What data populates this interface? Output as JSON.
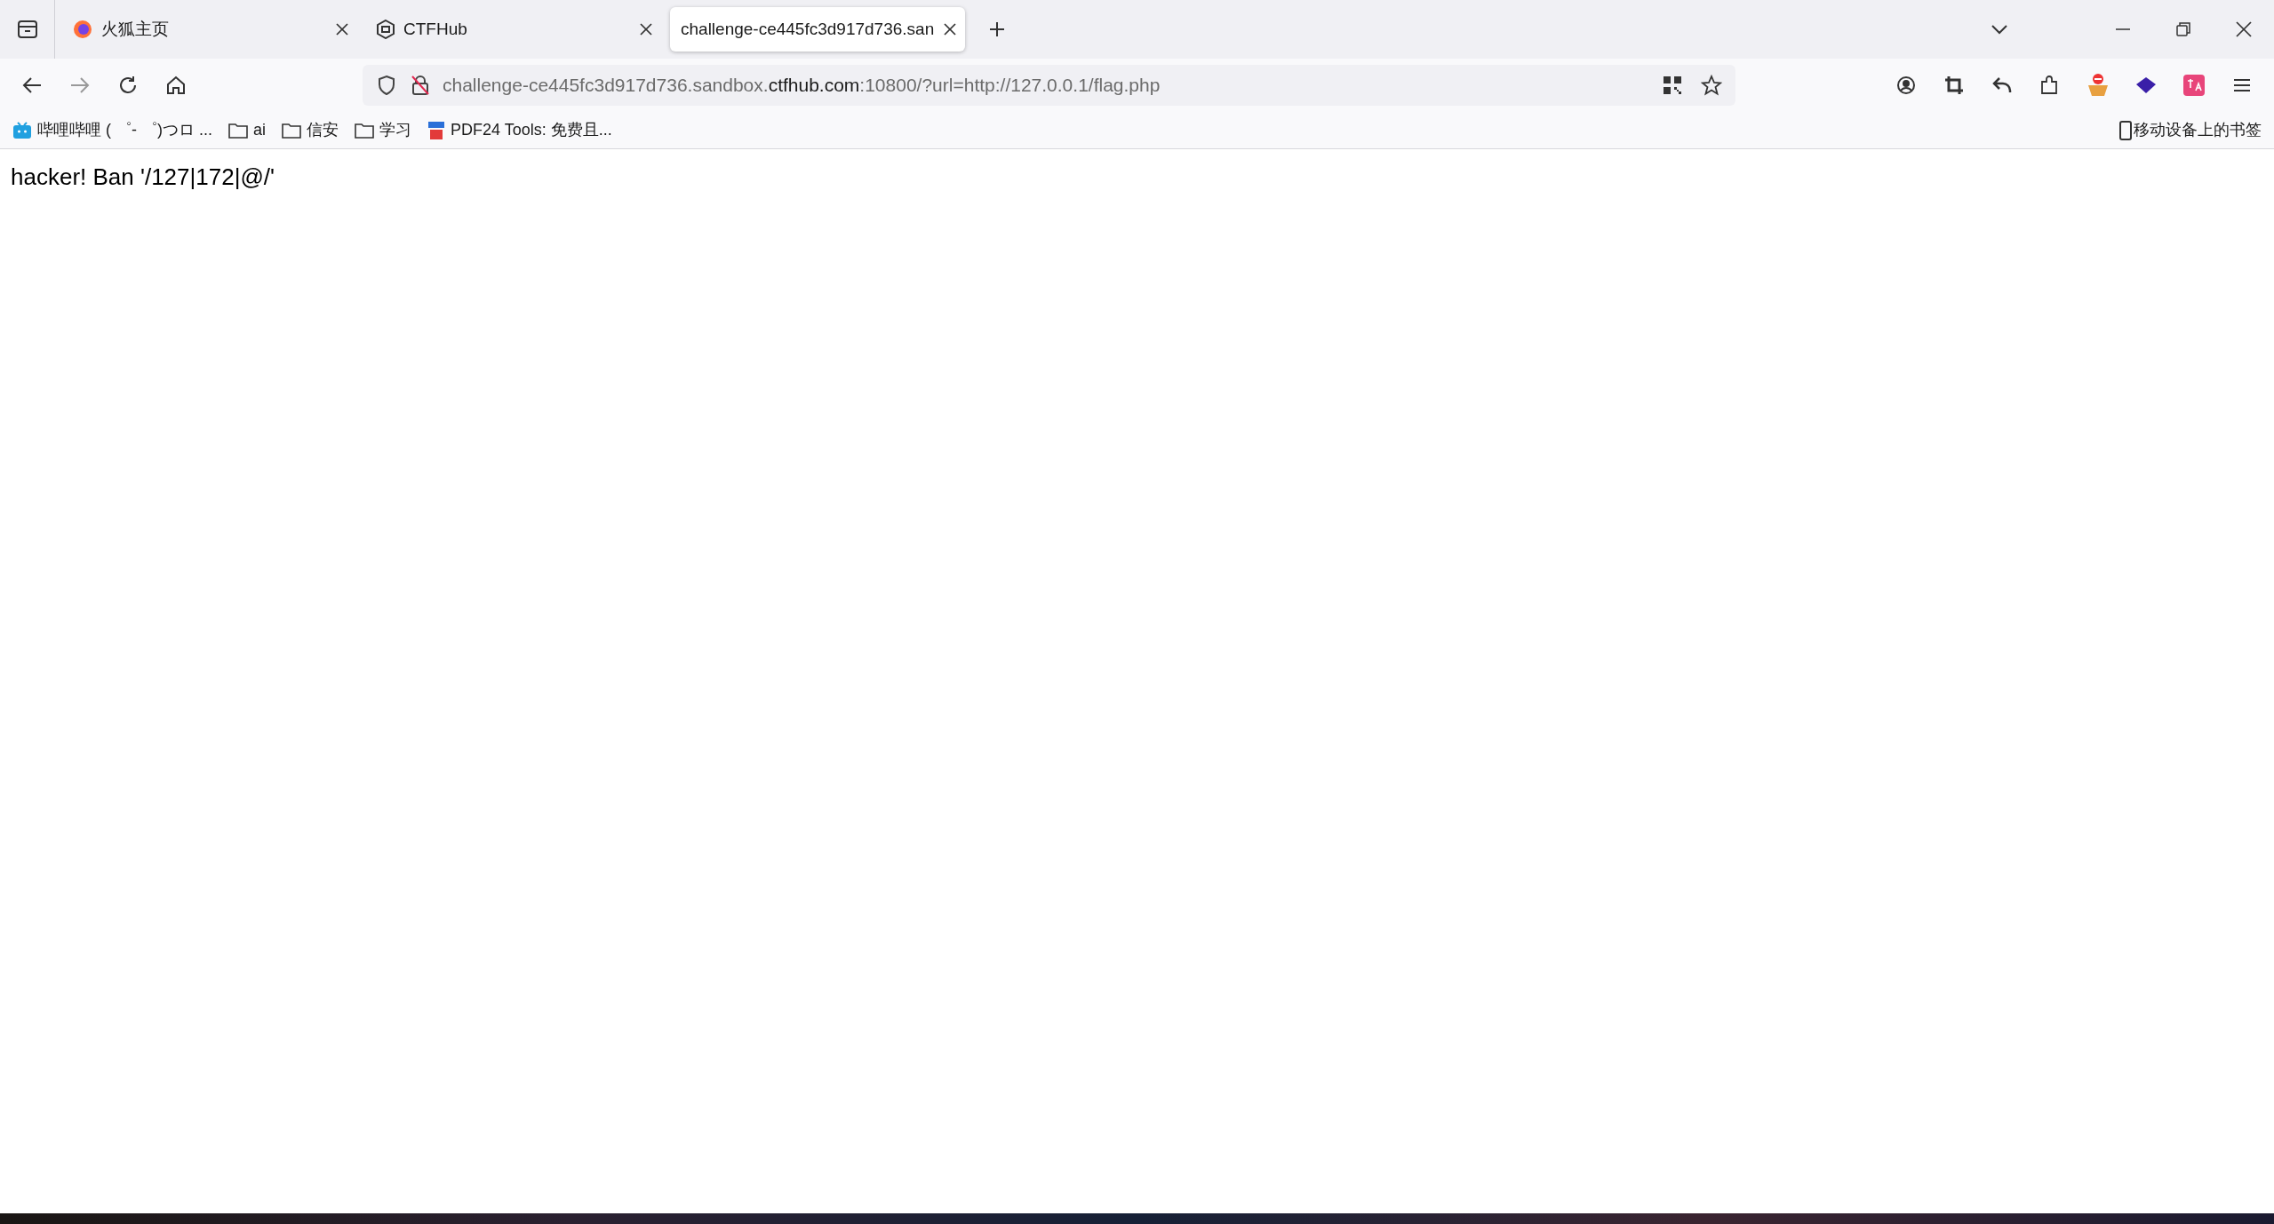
{
  "tabs": [
    {
      "kind": "firefox",
      "title": "火狐主页",
      "selected": false
    },
    {
      "kind": "ctfhub",
      "title": "CTFHub",
      "selected": false
    },
    {
      "kind": "plain",
      "title": "challenge-ce445fc3d917d736.san",
      "selected": true
    }
  ],
  "address_bar": {
    "url_prefix": "challenge-ce445fc3d917d736.sandbox.",
    "url_domain": "ctfhub.com",
    "url_suffix": ":10800/?url=http://127.0.0.1/flag.php"
  },
  "bookmarks": [
    {
      "kind": "bilibili",
      "label": "哔哩哔哩 ( ゜- ゜)つロ ..."
    },
    {
      "kind": "folder",
      "label": "ai"
    },
    {
      "kind": "folder",
      "label": "信安"
    },
    {
      "kind": "folder",
      "label": "学习"
    },
    {
      "kind": "pdf",
      "label": "PDF24 Tools: 免费且..."
    }
  ],
  "mobile_bookmarks": "移动设备上的书签",
  "page_text": "hacker! Ban '/127|172|@/'"
}
